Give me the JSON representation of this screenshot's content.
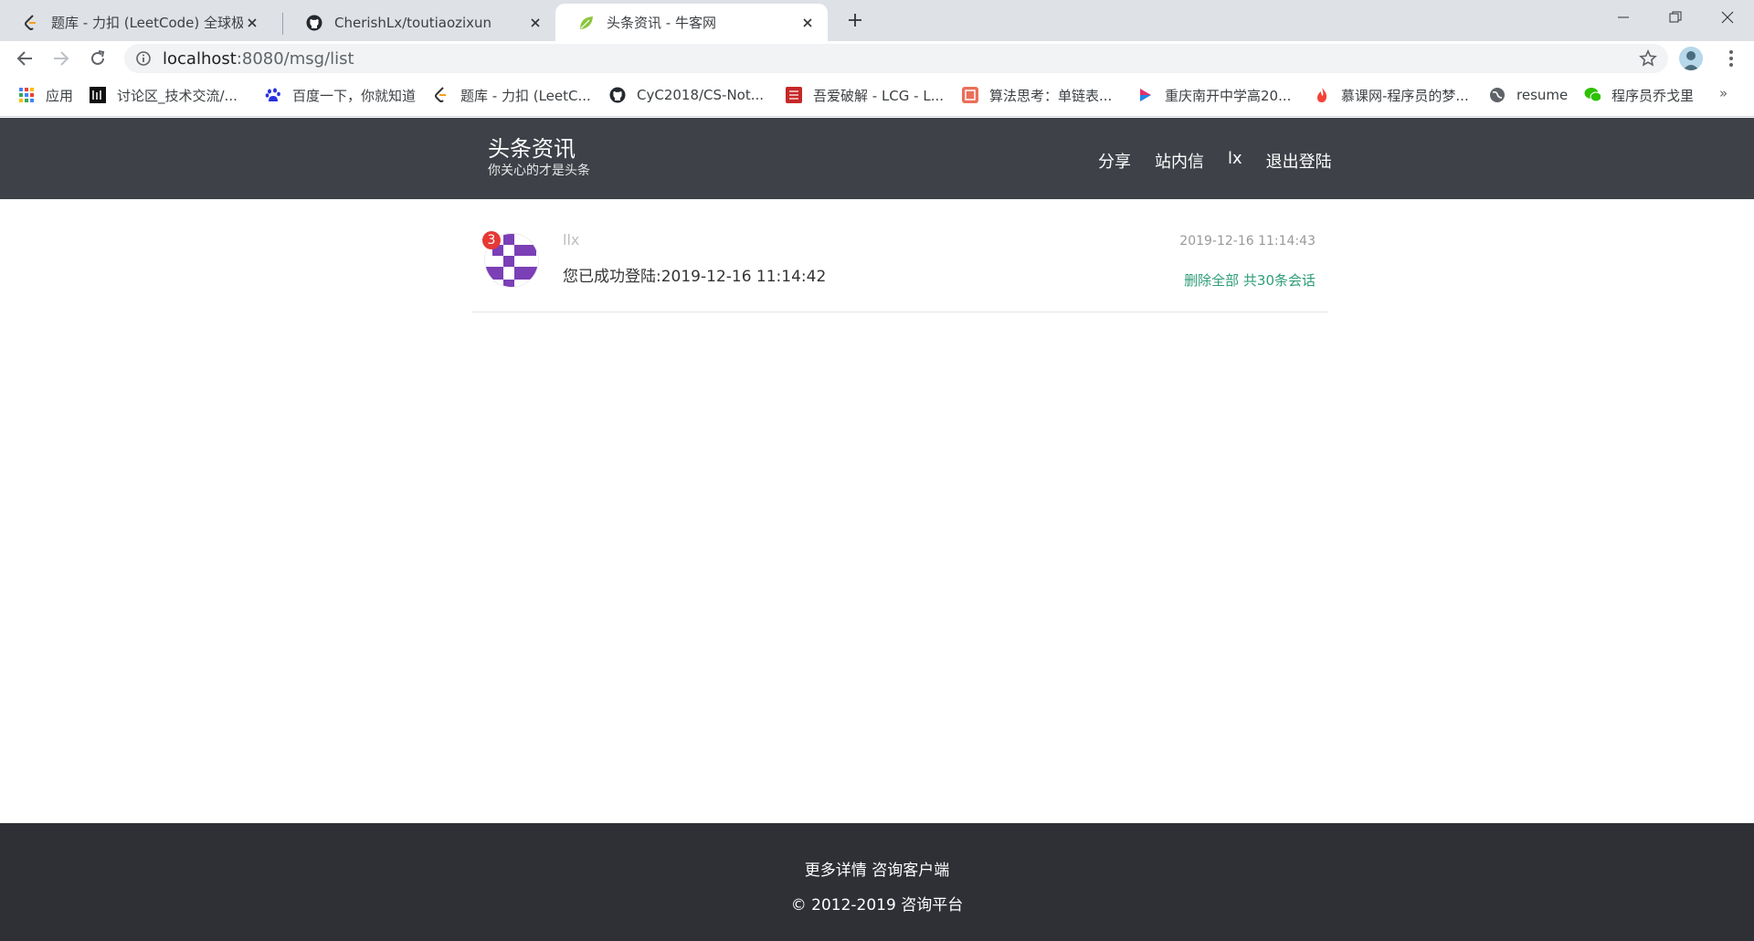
{
  "browser": {
    "tabs": [
      {
        "title": "题库 - 力扣 (LeetCode) 全球极客挚爱的技术成长平台",
        "icon": "leetcode-icon",
        "active": false
      },
      {
        "title": "CherishLx/toutiaozixun",
        "icon": "github-icon",
        "active": false
      },
      {
        "title": "头条资讯 - 牛客网",
        "icon": "leaf-icon",
        "active": true
      }
    ],
    "url": {
      "host": "localhost",
      "path": ":8080/msg/list"
    },
    "bookmarks": [
      {
        "label": "应用",
        "icon": "apps-grid-icon"
      },
      {
        "label": "讨论区_技术交流/...",
        "icon": "nowcoder-icon"
      },
      {
        "label": "百度一下，你就知道",
        "icon": "baidu-paw-icon"
      },
      {
        "label": "题库 - 力扣 (LeetC...",
        "icon": "leetcode-icon"
      },
      {
        "label": "CyC2018/CS-Not...",
        "icon": "github-icon"
      },
      {
        "label": "吾爱破解 - LCG - L...",
        "icon": "52pojie-icon"
      },
      {
        "label": "算法思考：单链表...",
        "icon": "jianshu-icon"
      },
      {
        "label": "重庆南开中学高20...",
        "icon": "bilibili-icon"
      },
      {
        "label": "慕课网-程序员的梦...",
        "icon": "imooc-flame-icon"
      },
      {
        "label": "resume",
        "icon": "globe-icon"
      },
      {
        "label": "程序员乔戈里",
        "icon": "wechat-icon"
      }
    ],
    "more": "»"
  },
  "site": {
    "brand": {
      "name": "头条资讯",
      "slogan": "你关心的才是头条"
    },
    "nav": [
      "分享",
      "站内信",
      "lx",
      "退出登陆"
    ]
  },
  "messages": [
    {
      "user": "llx",
      "unread": "3",
      "content": "您已成功登陆:2019-12-16 11:14:42",
      "time": "2019-12-16 11:14:43",
      "action": "删除全部 共30条会话"
    }
  ],
  "footer": {
    "line1": "更多详情 咨询客户端",
    "line2": "© 2012-2019 咨询平台"
  },
  "colors": {
    "header_bg": "#3e4148",
    "footer_bg": "#2e3036",
    "accent_green": "#2e9d77",
    "badge_red": "#e53935",
    "avatar_purple": "#7b3fb6"
  }
}
